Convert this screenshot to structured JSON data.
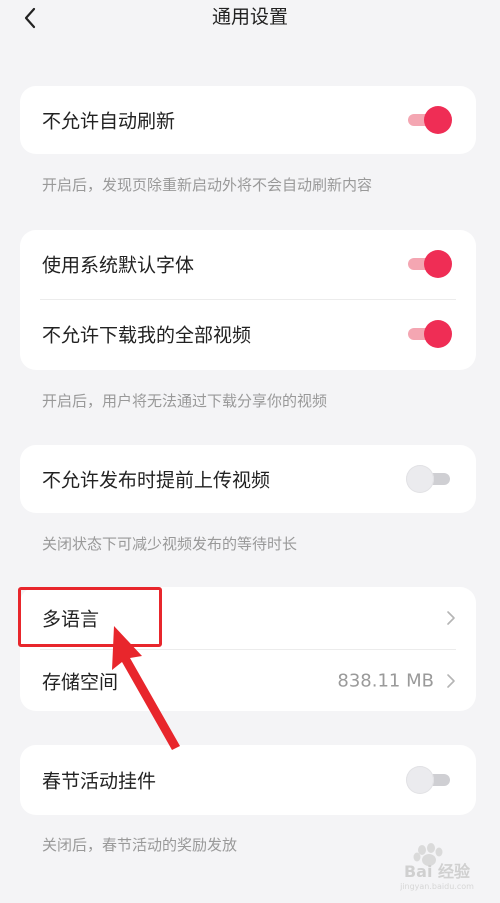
{
  "header": {
    "title": "通用设置",
    "back_icon": "chevron-left-icon"
  },
  "settings": {
    "no_auto_refresh": {
      "label": "不允许自动刷新",
      "enabled": true,
      "hint": "开启后，发现页除重新启动外将不会自动刷新内容"
    },
    "system_font": {
      "label": "使用系统默认字体",
      "enabled": true
    },
    "no_download_all_videos": {
      "label": "不允许下载我的全部视频",
      "enabled": true,
      "hint": "开启后，用户将无法通过下载分享你的视频"
    },
    "no_preupload": {
      "label": "不允许发布时提前上传视频",
      "enabled": false,
      "hint": "关闭状态下可减少视频发布的等待时长"
    },
    "language": {
      "label": "多语言"
    },
    "storage": {
      "label": "存储空间",
      "value": "838.11 MB"
    },
    "spring_widget": {
      "label": "春节活动挂件",
      "enabled": false,
      "hint": "关闭后，春节活动的奖励发放"
    }
  },
  "colors": {
    "toggle_on": "#ef2d55",
    "toggle_on_track": "#f4a6b2",
    "toggle_off": "#ebebee",
    "highlight_box": "#e8262c",
    "background": "#f4f4f6"
  },
  "watermark": {
    "logo_text": "Bai 经验",
    "sub_text": "jingyan.baidu.com"
  }
}
